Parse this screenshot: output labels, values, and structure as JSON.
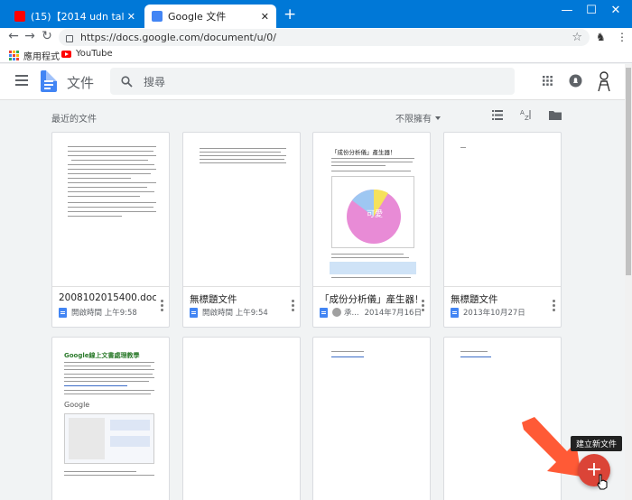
{
  "browser": {
    "tabs": [
      {
        "title": "(15)【2014 udn talks聯合",
        "favicon_color": "#ff0000"
      },
      {
        "title": "Google 文件",
        "favicon_color": "#4285f4"
      }
    ],
    "url": "https://docs.google.com/document/u/0/",
    "bookmarks": [
      {
        "label": "應用程式"
      },
      {
        "label": "YouTube"
      }
    ]
  },
  "header": {
    "app_title": "文件",
    "search_placeholder": "搜尋"
  },
  "main": {
    "section_title": "最近的文件",
    "owner_filter": "不限擁有",
    "documents": [
      {
        "name": "2008102015400.doc",
        "meta": "開啟時間 上午9:58",
        "owner_icon": "doc"
      },
      {
        "name": "無標題文件",
        "meta": "開啟時間 上午9:54",
        "owner_icon": "doc"
      },
      {
        "name": "「成份分析儀」產生器！",
        "meta": "2014年7月16日",
        "owner_icon": "shared",
        "owner_name": "承..."
      },
      {
        "name": "無標題文件",
        "meta": "2013年10月27日",
        "owner_icon": "doc"
      }
    ],
    "thumb_texts": {
      "analyzer_title": "「成份分析儀」產生器！",
      "analyzer_pie_label": "可愛\n(T&S)",
      "docs_tutorial_title": "Google線上文書處理教學",
      "google_logo": "Google"
    }
  },
  "fab": {
    "symbol": "+",
    "tooltip": "建立新文件",
    "color": "#db4437"
  }
}
